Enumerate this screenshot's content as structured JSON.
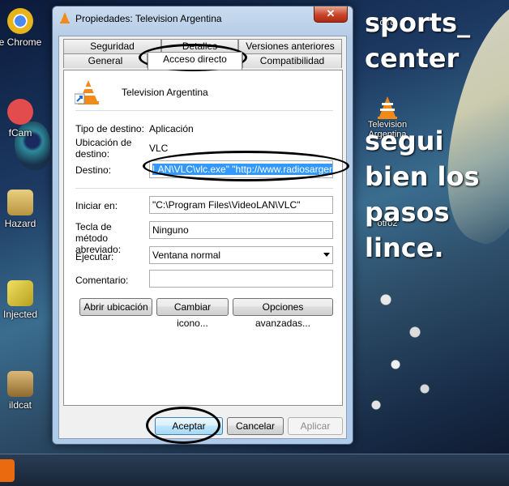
{
  "desktop": {
    "left_icons": [
      {
        "label": "e Chrome",
        "icon": "chrome-icon",
        "color": "#e8b41c"
      },
      {
        "label": "fCam",
        "icon": "camera-icon",
        "color": "#e24c4c"
      },
      {
        "label": "Hazard",
        "icon": "folder-icon",
        "color": "#d8b860"
      },
      {
        "label": "Injected",
        "icon": "game-icon",
        "color": "#e8d44c"
      },
      {
        "label": "ildcat",
        "icon": "folder-icon",
        "color": "#c89c50"
      }
    ],
    "right_icons": [
      {
        "label": "otro",
        "icon": "shortcut-icon"
      },
      {
        "label": "Television Argentina",
        "icon": "vlc-icon"
      },
      {
        "label": "otro2",
        "icon": "shortcut-icon"
      }
    ],
    "overlay_text": {
      "line1": "sports_",
      "line2": "center",
      "line3": "segui",
      "line4": "bien los",
      "line5": "pasos",
      "line6": "lince."
    }
  },
  "window": {
    "title": "Propiedades: Television Argentina",
    "close_label": "✕",
    "tabs_row1": [
      "Seguridad",
      "Detalles",
      "Versiones anteriores"
    ],
    "tabs_row2": [
      "General",
      "Acceso directo",
      "Compatibilidad"
    ],
    "active_tab": "Acceso directo",
    "app_name": "Television Argentina",
    "fields": {
      "tipo_destino_label": "Tipo de destino:",
      "tipo_destino_value": "Aplicación",
      "ubicacion_label": "Ubicación de destino:",
      "ubicacion_value": "VLC",
      "destino_label": "Destino:",
      "destino_value": "LAN\\VLC\\vlc.exe\" \"http://www.radiosargentina",
      "iniciar_label": "Iniciar en:",
      "iniciar_value": "\"C:\\Program Files\\VideoLAN\\VLC\"",
      "tecla_label": "Tecla de método abreviado:",
      "tecla_value": "Ninguno",
      "ejecutar_label": "Ejecutar:",
      "ejecutar_value": "Ventana normal",
      "comentario_label": "Comentario:",
      "comentario_value": ""
    },
    "buttons": {
      "abrir": "Abrir ubicación",
      "cambiar": "Cambiar icono...",
      "opciones": "Opciones avanzadas...",
      "aceptar": "Aceptar",
      "cancelar": "Cancelar",
      "aplicar": "Aplicar"
    }
  }
}
